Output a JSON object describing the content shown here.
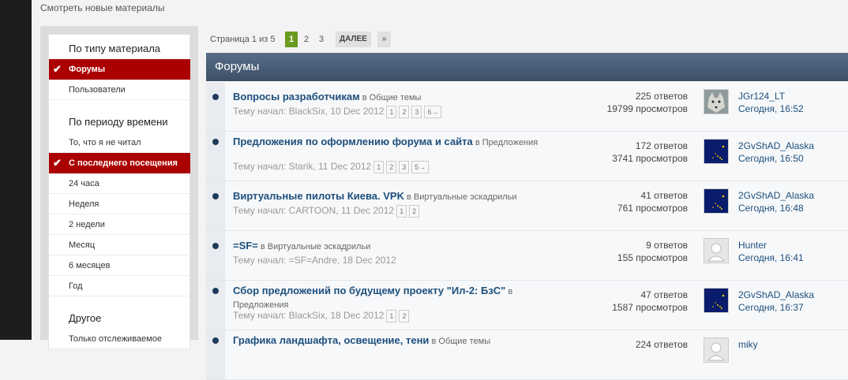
{
  "top_link": "Смотреть новые материалы",
  "sidebar": {
    "heading_type": "По типу материала",
    "type_items": [
      {
        "label": "Форумы",
        "active": true
      },
      {
        "label": "Пользователи",
        "active": false
      }
    ],
    "heading_period": "По периоду времени",
    "period_items": [
      {
        "label": "То, что я не читал",
        "active": false
      },
      {
        "label": "С последнего посещения",
        "active": true
      },
      {
        "label": "24 часа",
        "active": false
      },
      {
        "label": "Неделя",
        "active": false
      },
      {
        "label": "2 недели",
        "active": false
      },
      {
        "label": "Месяц",
        "active": false
      },
      {
        "label": "6 месяцев",
        "active": false
      },
      {
        "label": "Год",
        "active": false
      }
    ],
    "heading_other": "Другое",
    "other_items": [
      {
        "label": "Только отслеживаемое",
        "active": false
      }
    ]
  },
  "pagination": {
    "label": "Страница 1 из 5",
    "current": "1",
    "pages": [
      "2",
      "3"
    ],
    "next_label": "ДАЛЕЕ",
    "last_label": "»"
  },
  "main": {
    "title": "Форумы",
    "topics": [
      {
        "title": "Вопросы разработчикам",
        "in": "в Общие темы",
        "starter": "Тему начал: BlackSix, 10 Dec 2012",
        "pages": [
          "1",
          "2",
          "3",
          "6→"
        ],
        "replies": "225 ответов",
        "views": "19799 просмотров",
        "avatar": "wolf",
        "last_user": "JGr124_LT",
        "last_time": "Сегодня, 16:52"
      },
      {
        "title": "Предложения по оформлению форума и сайта",
        "in": "в Предложения",
        "starter": "Тему начал: Starik, 11 Dec 2012",
        "pages": [
          "1",
          "2",
          "3",
          "5→"
        ],
        "replies": "172 ответов",
        "views": "3741 просмотров",
        "avatar": "flag",
        "last_user": "2GvShAD_Alaska",
        "last_time": "Сегодня, 16:50"
      },
      {
        "title": "Виртуальные пилоты Киева. VPK",
        "in": "в Виртуальные эскадрильи",
        "starter": "Тему начал: CARTOON, 11 Dec 2012",
        "pages": [
          "1",
          "2"
        ],
        "replies": "41 ответов",
        "views": "761 просмотров",
        "avatar": "flag",
        "last_user": "2GvShAD_Alaska",
        "last_time": "Сегодня, 16:48"
      },
      {
        "title": "=SF=",
        "in": "в Виртуальные эскадрильи",
        "starter": "Тему начал: =SF=Andre, 18 Dec 2012",
        "pages": [],
        "replies": "9 ответов",
        "views": "155 просмотров",
        "avatar": "default",
        "last_user": "Hunter",
        "last_time": "Сегодня, 16:41"
      },
      {
        "title": "Сбор предложений по будущему проекту \"Ил-2: БзС\"",
        "in": "в Предложения",
        "starter": "Тему начал: BlackSix, 18 Dec 2012",
        "pages": [
          "1",
          "2"
        ],
        "replies": "47 ответов",
        "views": "1587 просмотров",
        "avatar": "flag",
        "last_user": "2GvShAD_Alaska",
        "last_time": "Сегодня, 16:37"
      },
      {
        "title": "Графика ландшафта, освещение, тени",
        "in": "в Общие темы",
        "starter": "",
        "pages": [],
        "replies": "224 ответов",
        "views": "",
        "avatar": "default",
        "last_user": "miky",
        "last_time": ""
      }
    ]
  },
  "colors": {
    "accent_red": "#ab0000",
    "header_blue": "#4a5d77",
    "link_blue": "#1d4f7d",
    "page_green": "#6a9a1f"
  }
}
